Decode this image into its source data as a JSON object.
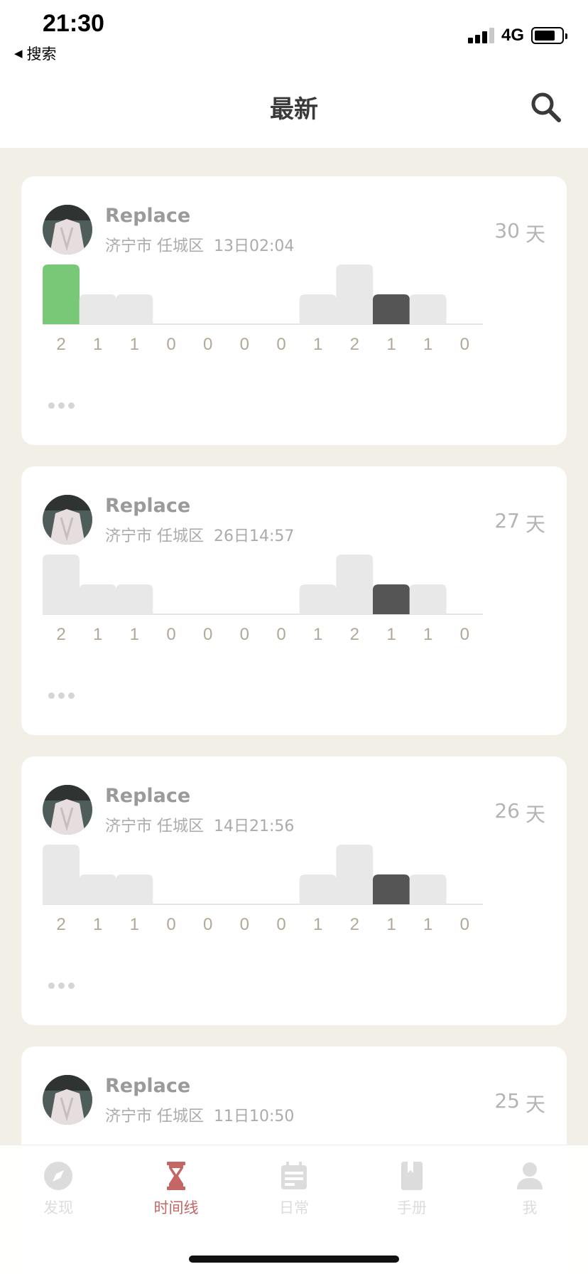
{
  "status_bar": {
    "time": "21:30",
    "back_label": "搜索",
    "network": "4G"
  },
  "header": {
    "title": "最新"
  },
  "chart_style": {
    "bar_color_default": "#e8e8e8",
    "bar_color_dark": "#555555",
    "bar_color_green": "#78c878",
    "value_color": "#b1a898"
  },
  "cards": [
    {
      "name": "Replace",
      "city": "济宁市",
      "district": "任城区",
      "datetime": "13日02:04",
      "days_count": "30",
      "days_unit": "天",
      "chart_data": {
        "type": "bar",
        "categories": [
          "2",
          "1",
          "1",
          "0",
          "0",
          "0",
          "0",
          "1",
          "2",
          "1",
          "1",
          "0"
        ],
        "values": [
          2,
          1,
          1,
          0,
          0,
          0,
          0,
          1,
          2,
          1,
          1,
          0
        ],
        "colors": [
          "green",
          "default",
          "default",
          "default",
          "default",
          "default",
          "default",
          "default",
          "default",
          "dark",
          "default",
          "default"
        ],
        "ylim": [
          0,
          2
        ]
      }
    },
    {
      "name": "Replace",
      "city": "济宁市",
      "district": "任城区",
      "datetime": "26日14:57",
      "days_count": "27",
      "days_unit": "天",
      "chart_data": {
        "type": "bar",
        "categories": [
          "2",
          "1",
          "1",
          "0",
          "0",
          "0",
          "0",
          "1",
          "2",
          "1",
          "1",
          "0"
        ],
        "values": [
          2,
          1,
          1,
          0,
          0,
          0,
          0,
          1,
          2,
          1,
          1,
          0
        ],
        "colors": [
          "default",
          "default",
          "default",
          "default",
          "default",
          "default",
          "default",
          "default",
          "default",
          "dark",
          "default",
          "default"
        ],
        "ylim": [
          0,
          2
        ]
      }
    },
    {
      "name": "Replace",
      "city": "济宁市",
      "district": "任城区",
      "datetime": "14日21:56",
      "days_count": "26",
      "days_unit": "天",
      "chart_data": {
        "type": "bar",
        "categories": [
          "2",
          "1",
          "1",
          "0",
          "0",
          "0",
          "0",
          "1",
          "2",
          "1",
          "1",
          "0"
        ],
        "values": [
          2,
          1,
          1,
          0,
          0,
          0,
          0,
          1,
          2,
          1,
          1,
          0
        ],
        "colors": [
          "default",
          "default",
          "default",
          "default",
          "default",
          "default",
          "default",
          "default",
          "default",
          "dark",
          "default",
          "default"
        ],
        "ylim": [
          0,
          2
        ]
      }
    },
    {
      "name": "Replace",
      "city": "济宁市",
      "district": "任城区",
      "datetime": "11日10:50",
      "days_count": "25",
      "days_unit": "天"
    }
  ],
  "tabbar": {
    "tabs": [
      {
        "label": "发现",
        "icon": "compass-icon",
        "active": false
      },
      {
        "label": "时间线",
        "icon": "hourglass-icon",
        "active": true
      },
      {
        "label": "日常",
        "icon": "calendar-icon",
        "active": false
      },
      {
        "label": "手册",
        "icon": "book-icon",
        "active": false
      },
      {
        "label": "我",
        "icon": "person-icon",
        "active": false
      }
    ],
    "active_color": "#c46664",
    "inactive_color": "#dcdcdc"
  }
}
